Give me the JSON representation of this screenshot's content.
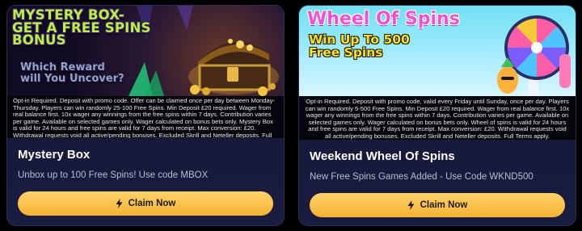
{
  "cards": [
    {
      "banner": {
        "headline": [
          "Mystery Box-",
          "Get A Free Spins",
          "Bonus"
        ],
        "subline": [
          "Which Reward",
          "will You Uncover?"
        ]
      },
      "terms": "Opt-in Required. Deposit with promo code. Offer can be claimed once per day between Monday-Thursday. Players can win randomly 25-100 Free Spins. Min Deposit £20 required. Wager from real balance first. 10x wager any winnings from the free spins within 7 days. Contribution varies per game. Available on selected games only. Wager calculated on bonus bets only. Mystery Box is valid for 24 hours and free spins are valid for 7 days from receipt. Max conversion: £20. Withdrawal requests void all active/pending bonuses. Excluded Skrill and Neteller deposits. Full Terms apply",
      "title": "Mystery Box",
      "description": "Unbox up to 100 Free Spins! Use code MBOX",
      "button_label": "Claim Now"
    },
    {
      "banner": {
        "headline": "Wheel Of Spins",
        "subline": [
          "Win Up To 500",
          "Free Spins"
        ]
      },
      "terms": "Opt-in Required. Deposit with promo code, valid every Friday until Sunday, once per day. Players can win randomly 5-500 Free Spins. Min Deposit £20 required. Wager from real balance first. 10x wager any winnings from the free spins within 7 days. Contribution varies per game. Available on selected games only. Wager calculated on bonus bets only. Wheel of spins is valid for 24 hours and free spins are valid for 7 days from receipt. Max conversion: £20. Withdrawal requests void all active/pending bonuses. Excluded Skrill and Neteller deposits. Full Terms apply.",
      "title": "Weekend Wheel Of Spins",
      "description": "New Free Spins Games Added - Use Code WKND500",
      "button_label": "Claim Now"
    }
  ],
  "icons": {
    "button": "lightning-bolt-icon"
  },
  "colors": {
    "card_bg": "#161a33",
    "button": "#f6b232",
    "mystery_headline": "#b8f23e",
    "wheel_headline": "#f050d8",
    "wheel_sub": "#ffe21d"
  }
}
